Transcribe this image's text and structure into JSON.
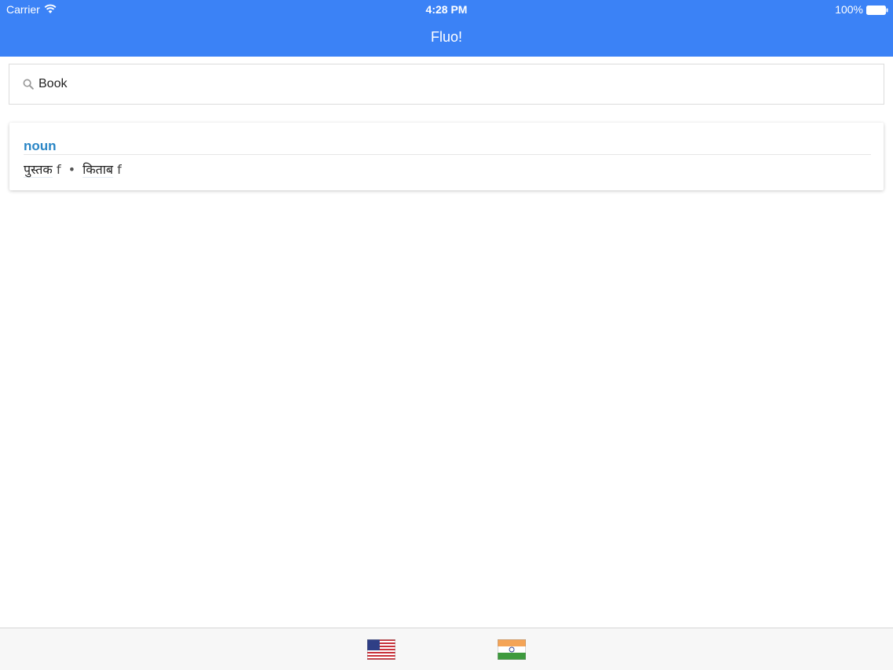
{
  "status_bar": {
    "carrier": "Carrier",
    "time": "4:28 PM",
    "battery": "100%"
  },
  "nav": {
    "title": "Fluo!"
  },
  "search": {
    "value": "Book",
    "icon": "search-icon"
  },
  "result": {
    "part_of_speech": "noun",
    "translations": [
      {
        "word": "पुस्तक",
        "gender": "f"
      },
      {
        "word": "किताब",
        "gender": "f"
      }
    ],
    "separator": "•"
  },
  "tabs": [
    {
      "name": "us-flag-icon"
    },
    {
      "name": "india-flag-icon"
    }
  ],
  "colors": {
    "header": "#3b82f6",
    "pos_label": "#2a86c6"
  }
}
